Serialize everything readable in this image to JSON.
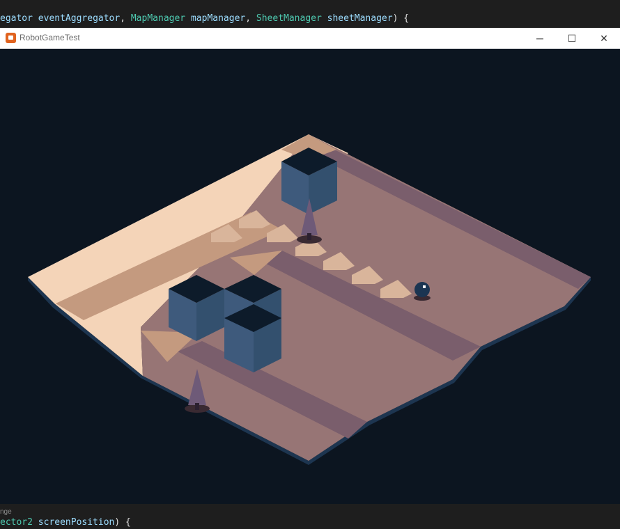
{
  "editor_top": {
    "tokens": [
      {
        "text": "egator ",
        "cls": "t-var"
      },
      {
        "text": "eventAggregator",
        "cls": "t-var"
      },
      {
        "text": ", ",
        "cls": "t-plain"
      },
      {
        "text": "MapManager",
        "cls": "t-type"
      },
      {
        "text": " mapManager",
        "cls": "t-var"
      },
      {
        "text": ", ",
        "cls": "t-plain"
      },
      {
        "text": "SheetManager",
        "cls": "t-type"
      },
      {
        "text": " sheetManager",
        "cls": "t-var"
      },
      {
        "text": ") {",
        "cls": "t-plain"
      }
    ]
  },
  "window": {
    "title": "RobotGameTest",
    "min_glyph": "─",
    "max_glyph": "☐",
    "close_glyph": "✕"
  },
  "editor_bottom": {
    "hint": "nge",
    "tokens": [
      {
        "text": "ector2",
        "cls": "t-type"
      },
      {
        "text": " screenPosition",
        "cls": "t-var"
      },
      {
        "text": ") {",
        "cls": "t-plain"
      }
    ]
  },
  "scene": {
    "background": "#0c1520",
    "colors": {
      "sand_light": "#f4d4b8",
      "sand_mid": "#c49a7f",
      "ground_light": "#977575",
      "ground_dark": "#7a5e6c",
      "edge": "#1d3550",
      "arrow": "#d9b59b",
      "block_top": "#0d1b2a",
      "brick": "#3e5a7c",
      "robot": "#1b3552"
    }
  }
}
